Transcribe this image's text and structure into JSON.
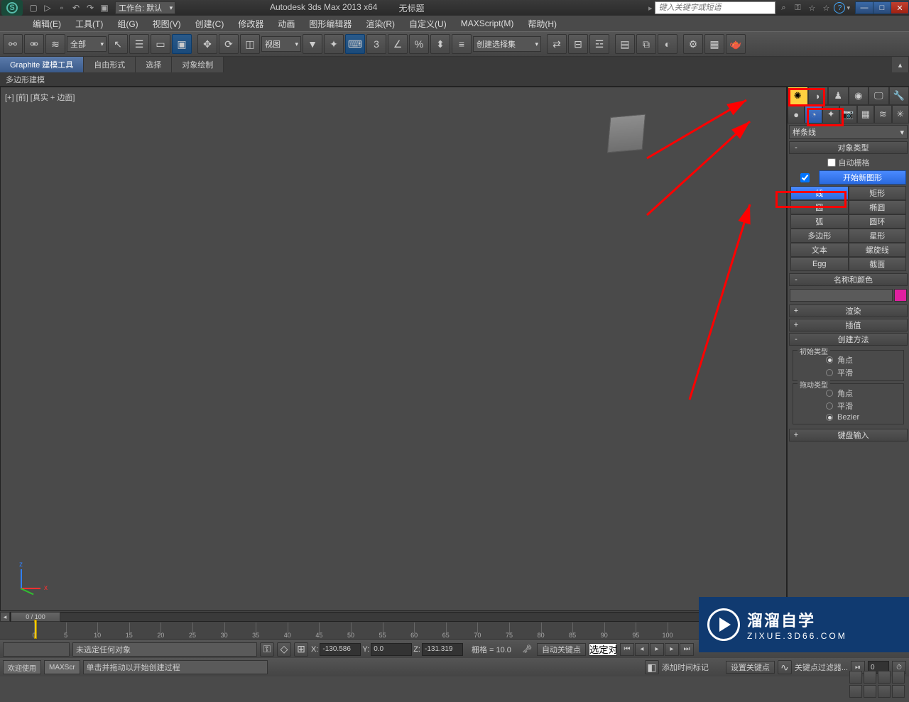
{
  "title": {
    "app": "Autodesk 3ds Max  2013 x64",
    "doc": "无标题",
    "workspace": "工作台: 默认"
  },
  "search": {
    "placeholder": "键入关键字或短语"
  },
  "menus": [
    "编辑(E)",
    "工具(T)",
    "组(G)",
    "视图(V)",
    "创建(C)",
    "修改器",
    "动画",
    "图形编辑器",
    "渲染(R)",
    "自定义(U)",
    "MAXScript(M)",
    "帮助(H)"
  ],
  "toolbar": {
    "filter_all": "全部",
    "refcoord": "视图",
    "createset": "创建选择集"
  },
  "ribbon": {
    "tabs": [
      "Graphite 建模工具",
      "自由形式",
      "选择",
      "对象绘制"
    ],
    "sub": "多边形建模"
  },
  "viewport": {
    "label": "[+] [前] [真实 + 边面]"
  },
  "cmd": {
    "dropdown": "样条线",
    "rollout_objtype": "对象类型",
    "autogrid": "自动栅格",
    "newshape": "开始新图形",
    "buttons": [
      "线",
      "矩形",
      "圆",
      "椭圆",
      "弧",
      "圆环",
      "多边形",
      "星形",
      "文本",
      "螺旋线",
      "Egg",
      "截面"
    ],
    "rollout_namecol": "名称和颜色",
    "rollout_render": "渲染",
    "rollout_interp": "插值",
    "rollout_method": "创建方法",
    "init_type": "初始类型",
    "drag_type": "拖动类型",
    "r_corner": "角点",
    "r_smooth": "平滑",
    "r_bezier": "Bezier",
    "rollout_keyboard": "键盘输入"
  },
  "timeline": {
    "frame": "0 / 100"
  },
  "status": {
    "prompt1": "未选定任何对象",
    "prompt2": "单击并拖动以开始创建过程",
    "x": "-130.586",
    "y": "0.0",
    "z": "-131.319",
    "grid": "栅格 = 10.0",
    "autokey": "自动关键点",
    "setkey": "设置关键点",
    "selected": "选定对",
    "keyfilter": "关键点过滤器...",
    "addtime": "添加时间标记",
    "curframe": "0"
  },
  "welcome": {
    "t1": "欢迎使用",
    "t2": "MAXScr"
  },
  "watermark": {
    "t1": "溜溜自学",
    "t2": "ZIXUE.3D66.COM"
  }
}
